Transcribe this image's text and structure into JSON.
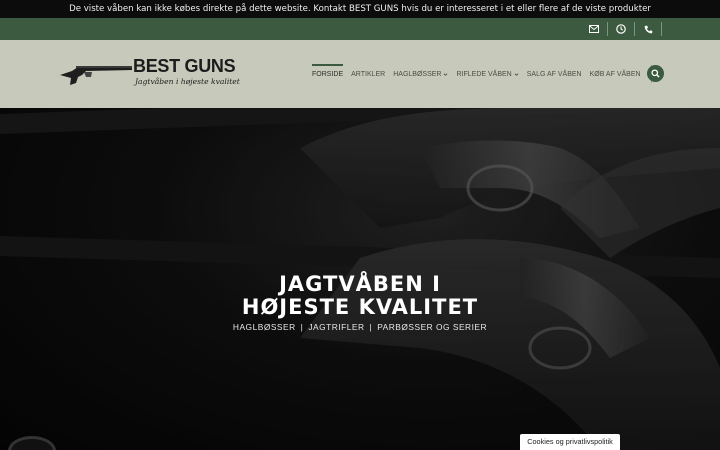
{
  "notice": {
    "text": "De viste våben kan ikke købes direkte på dette website. Kontakt BEST GUNS hvis du er interesseret i et eller flere af de viste produkter"
  },
  "topbar": {
    "icons": [
      "mail-icon",
      "clock-icon",
      "phone-icon"
    ]
  },
  "logo": {
    "brand": "BEST GUNS",
    "tagline": "Jagtvåben i højeste kvalitet"
  },
  "nav": {
    "items": [
      {
        "label": "FORSIDE",
        "active": true
      },
      {
        "label": "ARTIKLER"
      },
      {
        "label": "HAGLBØSSER",
        "dropdown": true
      },
      {
        "label": "RIFLEDE VÅBEN",
        "dropdown": true
      },
      {
        "label": "SALG AF VÅBEN"
      },
      {
        "label": "KØB AF VÅBEN"
      }
    ]
  },
  "hero": {
    "title_line1": "JAGTVÅBEN I",
    "title_line2": "HØJESTE KVALITET",
    "sub": [
      "HAGLBØSSER",
      "JAGTRIFLER",
      "PARBØSSER OG SERIER"
    ],
    "separator": "|"
  },
  "cookie": {
    "label": "Cookies og privatlivspolitik"
  },
  "colors": {
    "accent": "#3b5a3f",
    "header_bg": "#c7c9bb",
    "notice_bg": "#0c0c0c"
  }
}
